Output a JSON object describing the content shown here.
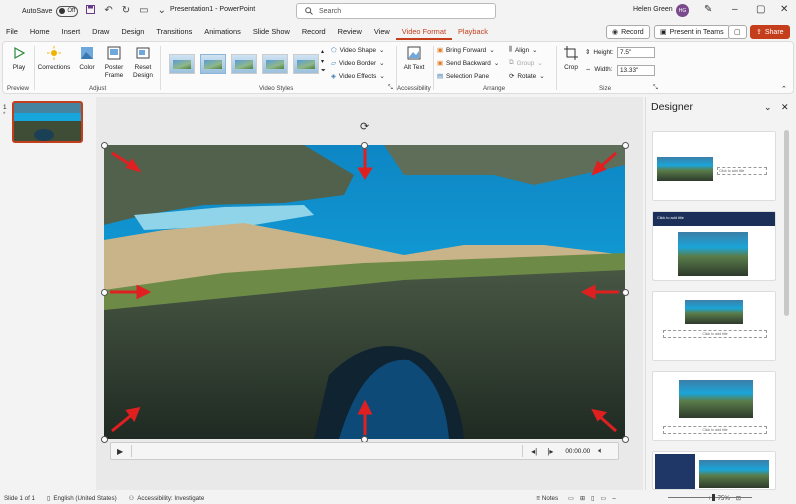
{
  "titlebar": {
    "autosave_label": "AutoSave",
    "autosave_state": "Off",
    "title": "Presentation1 - PowerPoint",
    "search_placeholder": "Search",
    "user_name": "Helen Green",
    "user_initials": "HG"
  },
  "tabs": [
    "File",
    "Home",
    "Insert",
    "Draw",
    "Design",
    "Transitions",
    "Animations",
    "Slide Show",
    "Record",
    "Review",
    "View",
    "Video Format",
    "Playback"
  ],
  "active_tab": "Video Format",
  "tab_actions": {
    "record": "Record",
    "teams": "Present in Teams",
    "share": "Share"
  },
  "ribbon": {
    "preview": {
      "play": "Play",
      "label": "Preview"
    },
    "adjust": {
      "corrections": "Corrections",
      "color": "Color",
      "poster": "Poster Frame",
      "reset": "Reset Design",
      "label": "Adjust"
    },
    "video_styles": {
      "shape": "Video Shape",
      "border": "Video Border",
      "effects": "Video Effects",
      "label": "Video Styles"
    },
    "accessibility": {
      "alt": "Alt Text",
      "label": "Accessibility"
    },
    "arrange": {
      "bring": "Bring Forward",
      "send": "Send Backward",
      "pane": "Selection Pane",
      "align": "Align",
      "group": "Group",
      "rotate": "Rotate",
      "label": "Arrange"
    },
    "size": {
      "crop": "Crop",
      "height_label": "Height:",
      "height_value": "7.5\"",
      "width_label": "Width:",
      "width_value": "13.33\"",
      "label": "Size"
    }
  },
  "slides": {
    "number": "1",
    "star": "*"
  },
  "video_controls": {
    "time": "00:00.00"
  },
  "designer": {
    "title": "Designer",
    "card_text": "Click to add title",
    "card_sub": "Click to add subtitle"
  },
  "status": {
    "slide": "Slide 1 of 1",
    "language": "English (United States)",
    "accessibility": "Accessibility: Investigate",
    "notes": "Notes",
    "zoom": "75%"
  }
}
